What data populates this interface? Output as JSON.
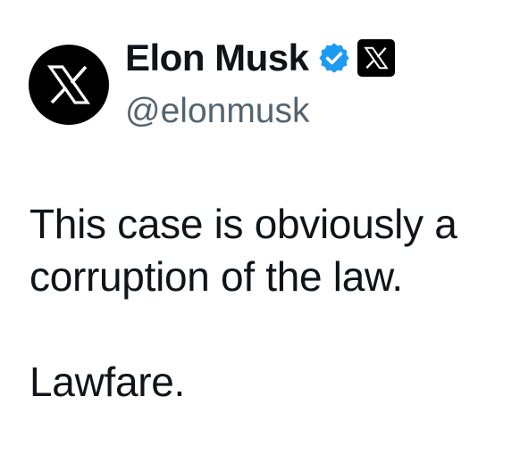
{
  "author": {
    "display_name": "Elon Musk",
    "handle": "@elonmusk",
    "avatar_icon": "x-logo-icon",
    "verified_icon": "verified-badge-icon",
    "affiliate_icon": "x-affiliate-badge-icon"
  },
  "tweet": {
    "lines": [
      "This case is obviously a",
      "corruption of the law.",
      "Lawfare."
    ]
  },
  "colors": {
    "text": "#0f1419",
    "handle": "#536471",
    "verified": "#1d9bf0",
    "avatar_bg": "#000000"
  }
}
